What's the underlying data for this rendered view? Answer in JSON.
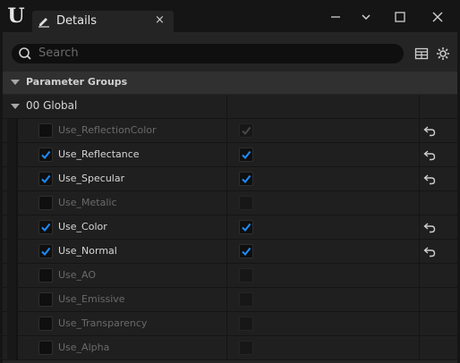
{
  "window": {
    "tab_title": "Details",
    "tab_close": "×",
    "tab_close_icon": "close-icon"
  },
  "search": {
    "placeholder": "Search"
  },
  "category": {
    "label": "Parameter Groups"
  },
  "group": {
    "label": "00 Global"
  },
  "parameters": [
    {
      "name": "Use_ReflectionColor",
      "checked": false,
      "value": true,
      "enabled": false,
      "reset": true
    },
    {
      "name": "Use_Reflectance",
      "checked": true,
      "value": true,
      "enabled": true,
      "reset": true
    },
    {
      "name": "Use_Specular",
      "checked": true,
      "value": true,
      "enabled": true,
      "reset": true
    },
    {
      "name": "Use_Metalic",
      "checked": false,
      "value": false,
      "enabled": false,
      "reset": false
    },
    {
      "name": "Use_Color",
      "checked": true,
      "value": true,
      "enabled": true,
      "reset": true
    },
    {
      "name": "Use_Normal",
      "checked": true,
      "value": true,
      "enabled": true,
      "reset": true
    },
    {
      "name": "Use_AO",
      "checked": false,
      "value": false,
      "enabled": false,
      "reset": false
    },
    {
      "name": "Use_Emissive",
      "checked": false,
      "value": false,
      "enabled": false,
      "reset": false
    },
    {
      "name": "Use_Transparency",
      "checked": false,
      "value": false,
      "enabled": false,
      "reset": false
    },
    {
      "name": "Use_Alpha",
      "checked": false,
      "value": false,
      "enabled": false,
      "reset": false
    }
  ],
  "colors": {
    "accent": "#1e8cff",
    "check": "#1e8cff"
  }
}
